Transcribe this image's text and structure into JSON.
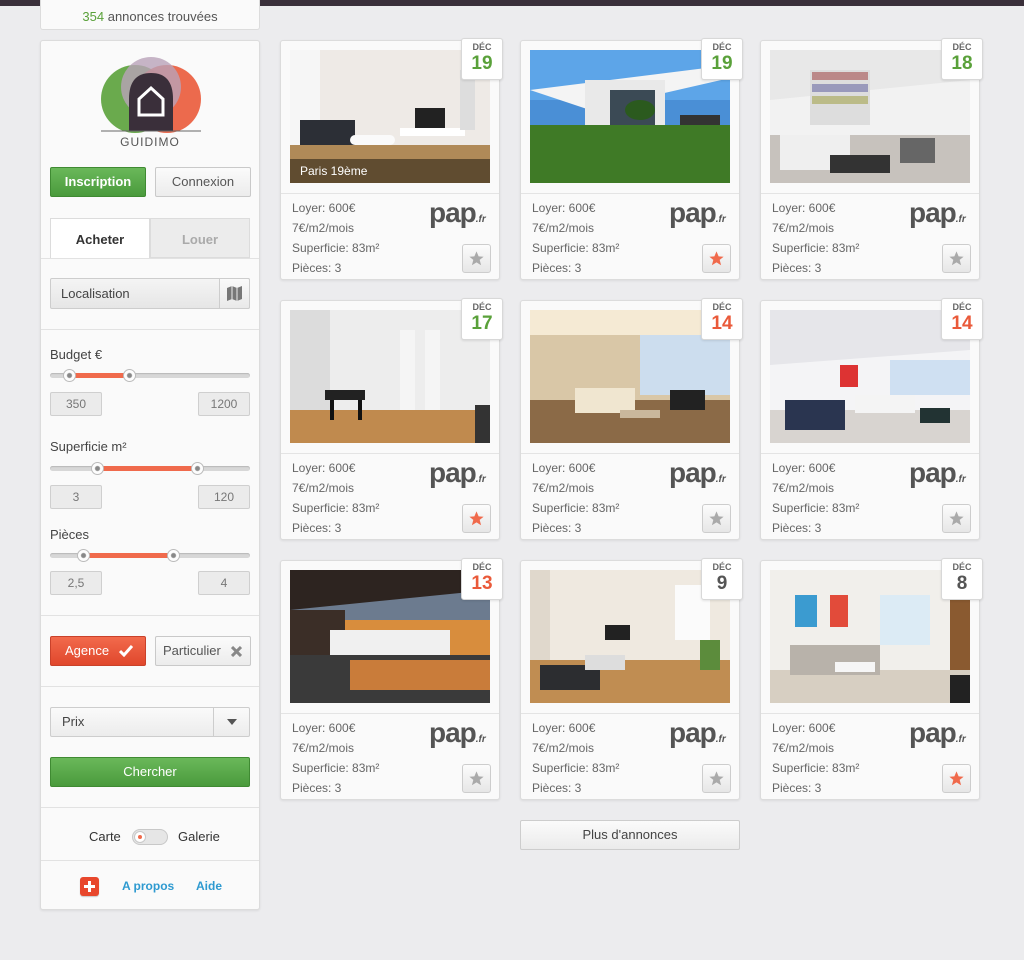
{
  "results": {
    "count": "354",
    "suffix": " annonces trouvées"
  },
  "brand": {
    "name": "GUIDIMO"
  },
  "auth": {
    "signup": "Inscription",
    "login": "Connexion"
  },
  "tabs": {
    "buy": "Acheter",
    "rent": "Louer"
  },
  "location": {
    "placeholder": "Localisation"
  },
  "filters": {
    "budget": {
      "label": "Budget €",
      "min": "350",
      "max": "1200",
      "range_low": 0.1,
      "range_high": 0.4
    },
    "surface": {
      "label": "Superficie m²",
      "min": "3",
      "max": "120",
      "range_low": 0.24,
      "range_high": 0.74
    },
    "rooms": {
      "label": "Pièces",
      "min": "2,5",
      "max": "4",
      "range_low": 0.17,
      "range_high": 0.62
    }
  },
  "seller": {
    "agency": "Agence",
    "private": "Particulier"
  },
  "sort": {
    "selected": "Prix"
  },
  "search_button": "Chercher",
  "view": {
    "map": "Carte",
    "gallery": "Galerie"
  },
  "footer": {
    "about": "A propos",
    "help": "Aide"
  },
  "colors": {
    "green": "#5aa13a",
    "red": "#ea5a3a",
    "accent": "#f06a4c"
  },
  "listings": [
    {
      "month": "DÉC",
      "day": "19",
      "day_color": "green",
      "caption": "Paris 19ème",
      "rent": "Loyer: 600€",
      "per_m2": "7€/m2/mois",
      "surface": "Superficie: 83m²",
      "rooms": "Pièces: 3",
      "favorite": false
    },
    {
      "month": "DÉC",
      "day": "19",
      "day_color": "green",
      "caption": "",
      "rent": "Loyer: 600€",
      "per_m2": "7€/m2/mois",
      "surface": "Superficie: 83m²",
      "rooms": "Pièces: 3",
      "favorite": true
    },
    {
      "month": "DÉC",
      "day": "18",
      "day_color": "green",
      "caption": "",
      "rent": "Loyer: 600€",
      "per_m2": "7€/m2/mois",
      "surface": "Superficie: 83m²",
      "rooms": "Pièces: 3",
      "favorite": false
    },
    {
      "month": "DÉC",
      "day": "17",
      "day_color": "green",
      "caption": "",
      "rent": "Loyer: 600€",
      "per_m2": "7€/m2/mois",
      "surface": "Superficie: 83m²",
      "rooms": "Pièces: 3",
      "favorite": true
    },
    {
      "month": "DÉC",
      "day": "14",
      "day_color": "red",
      "caption": "",
      "rent": "Loyer: 600€",
      "per_m2": "7€/m2/mois",
      "surface": "Superficie: 83m²",
      "rooms": "Pièces: 3",
      "favorite": false
    },
    {
      "month": "DÉC",
      "day": "14",
      "day_color": "red",
      "caption": "",
      "rent": "Loyer: 600€",
      "per_m2": "7€/m2/mois",
      "surface": "Superficie: 83m²",
      "rooms": "Pièces: 3",
      "favorite": false
    },
    {
      "month": "DÉC",
      "day": "13",
      "day_color": "red",
      "caption": "",
      "rent": "Loyer: 600€",
      "per_m2": "7€/m2/mois",
      "surface": "Superficie: 83m²",
      "rooms": "Pièces: 3",
      "favorite": false
    },
    {
      "month": "DÉC",
      "day": "9",
      "day_color": "dark",
      "caption": "",
      "rent": "Loyer: 600€",
      "per_m2": "7€/m2/mois",
      "surface": "Superficie: 83m²",
      "rooms": "Pièces: 3",
      "favorite": false
    },
    {
      "month": "DÉC",
      "day": "8",
      "day_color": "dark",
      "caption": "",
      "rent": "Loyer: 600€",
      "per_m2": "7€/m2/mois",
      "surface": "Superficie: 83m²",
      "rooms": "Pièces: 3",
      "favorite": true
    }
  ],
  "source_logo": {
    "main": "pap",
    "tld": ".fr"
  },
  "more_button": "Plus d'annonces"
}
